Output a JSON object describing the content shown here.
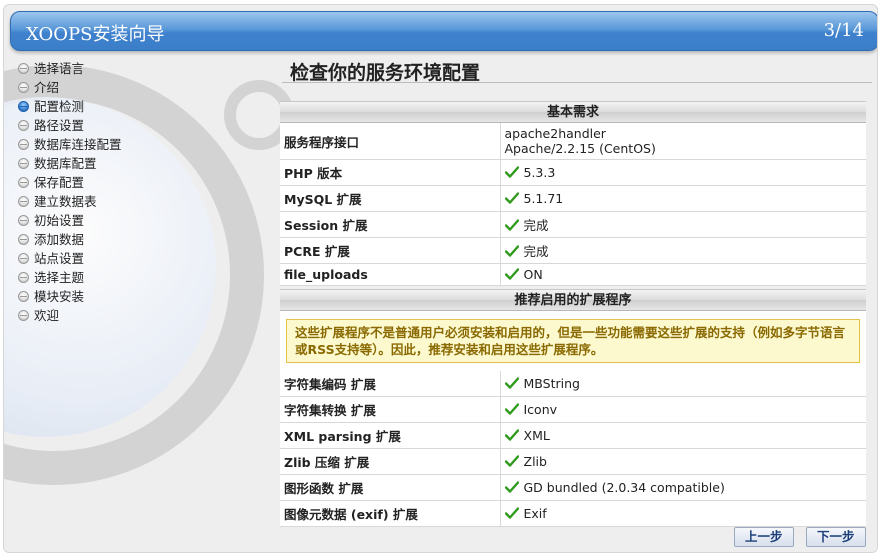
{
  "header": {
    "title": "XOOPS安装向导",
    "step": "3/14"
  },
  "nav": {
    "items": [
      {
        "label": "选择语言"
      },
      {
        "label": "介绍"
      },
      {
        "label": "配置检测",
        "active": true
      },
      {
        "label": "路径设置"
      },
      {
        "label": "数据库连接配置"
      },
      {
        "label": "数据库配置"
      },
      {
        "label": "保存配置"
      },
      {
        "label": "建立数据表"
      },
      {
        "label": "初始设置"
      },
      {
        "label": "添加数据"
      },
      {
        "label": "站点设置"
      },
      {
        "label": "选择主题"
      },
      {
        "label": "模块安装"
      },
      {
        "label": "欢迎"
      }
    ]
  },
  "main": {
    "title": "检查你的服务环境配置",
    "basic": {
      "heading": "基本需求",
      "rows": [
        {
          "key": "服务程序接口",
          "value": "apache2handler",
          "value2": "Apache/2.2.15 (CentOS)",
          "ok": false
        },
        {
          "key": "PHP 版本",
          "value": "5.3.3",
          "ok": true
        },
        {
          "key": "MySQL 扩展",
          "value": "5.1.71",
          "ok": true
        },
        {
          "key": "Session 扩展",
          "value": "完成",
          "ok": true
        },
        {
          "key": "PCRE 扩展",
          "value": "完成",
          "ok": true
        },
        {
          "key": "file_uploads",
          "value": "ON",
          "ok": true
        }
      ]
    },
    "recommended": {
      "heading": "推荐启用的扩展程序",
      "notice": "这些扩展程序不是普通用户必须安装和启用的，但是一些功能需要这些扩展的支持（例如多字节语言或RSS支持等）。因此，推荐安装和启用这些扩展程序。",
      "rows": [
        {
          "key": "字符集编码 扩展",
          "value": "MBString",
          "ok": true
        },
        {
          "key": "字符集转换 扩展",
          "value": "Iconv",
          "ok": true
        },
        {
          "key": "XML parsing 扩展",
          "value": "XML",
          "ok": true
        },
        {
          "key": "Zlib 压缩 扩展",
          "value": "Zlib",
          "ok": true
        },
        {
          "key": "图形函数 扩展",
          "value": "GD bundled (2.0.34 compatible)",
          "ok": true
        },
        {
          "key": "图像元数据 (exif) 扩展",
          "value": "Exif",
          "ok": true
        }
      ]
    }
  },
  "buttons": {
    "prev": "上一步",
    "next": "下一步"
  },
  "colors": {
    "accent": "#3f81cd",
    "check": "#2f9a1c",
    "notice_bg": "#fcf9cf",
    "notice_text": "#8a6a00"
  }
}
